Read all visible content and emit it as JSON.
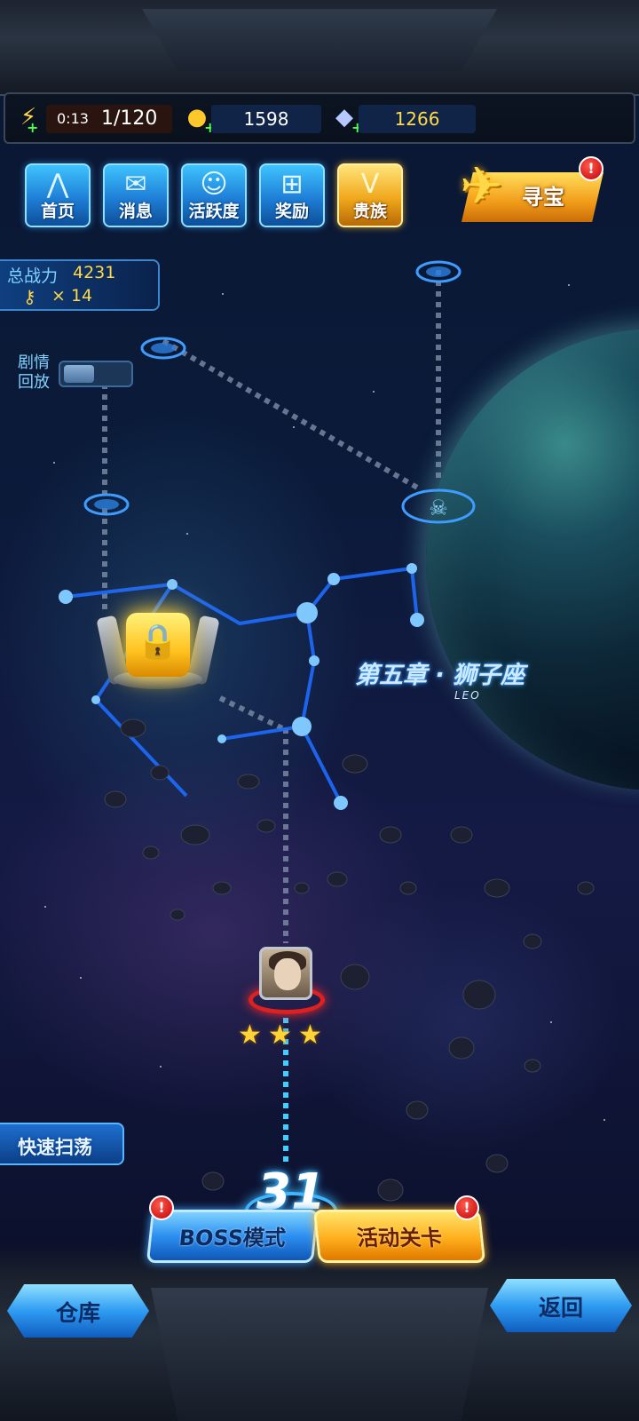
{
  "resources": {
    "energy_timer": "0:13",
    "energy": "1/120",
    "gold": "1598",
    "diamonds": "1266",
    "plus": "+"
  },
  "nav": [
    {
      "label": "首页",
      "icon": "home-icon"
    },
    {
      "label": "消息",
      "icon": "mail-icon"
    },
    {
      "label": "活跃度",
      "icon": "smile-wings-icon"
    },
    {
      "label": "奖励",
      "icon": "gift-icon"
    },
    {
      "label": "贵族",
      "icon": "noble-badge-icon"
    }
  ],
  "treasure": {
    "label": "寻宝",
    "badge": "!"
  },
  "stats": {
    "power_label": "总战力",
    "power_value": "4231",
    "keys": "× 14"
  },
  "replay": {
    "label": "剧情回放"
  },
  "chapter": {
    "title": "第五章 · 狮子座",
    "subtitle": "LEO"
  },
  "stage": {
    "number": "31",
    "stars": [
      "★",
      "★",
      "★"
    ]
  },
  "buttons": {
    "sweep": "快速扫荡",
    "boss": "BOSS模式",
    "event": "活动关卡",
    "warehouse": "仓库",
    "back": "返回",
    "badge": "!"
  },
  "colors": {
    "accent_blue": "#3fb7ff",
    "accent_gold": "#ffc21f",
    "alert_red": "#e0201f"
  }
}
